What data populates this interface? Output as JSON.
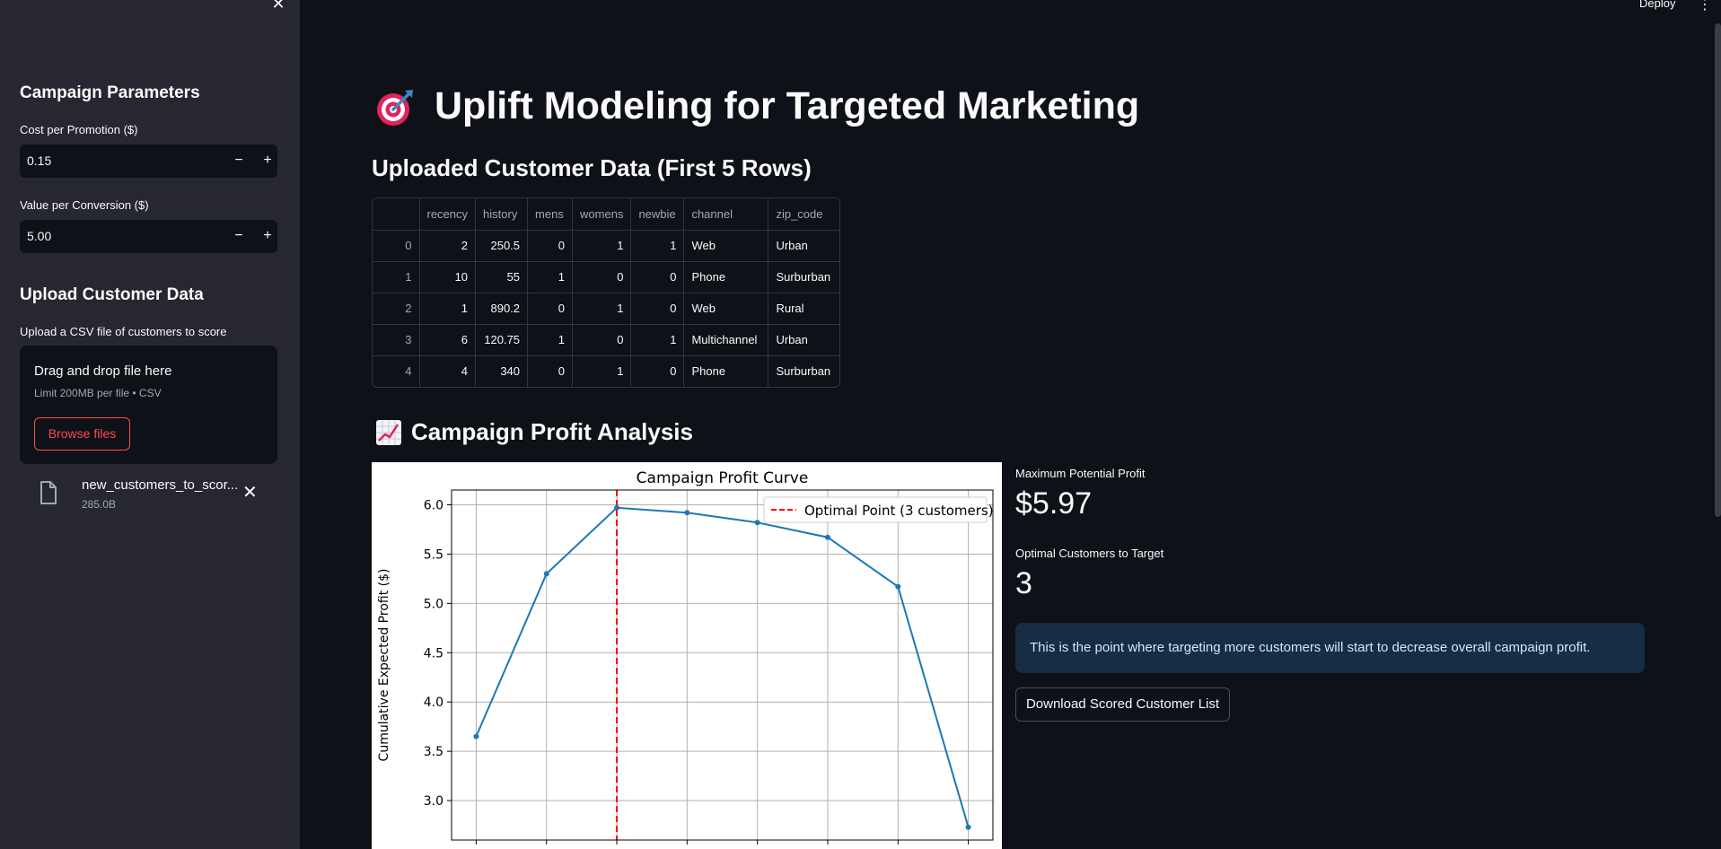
{
  "header": {
    "deploy_label": "Deploy",
    "menu_glyph": "⋮"
  },
  "sidebar": {
    "close_glyph": "✕",
    "campaign_heading": "Campaign Parameters",
    "cost": {
      "label": "Cost per Promotion ($)",
      "value": "0.15"
    },
    "value_conv": {
      "label": "Value per Conversion ($)",
      "value": "5.00"
    },
    "stepper": {
      "minus": "−",
      "plus": "+"
    },
    "upload_heading": "Upload Customer Data",
    "upload_label": "Upload a CSV file of customers to score",
    "dropzone": {
      "title": "Drag and drop file here",
      "limit": "Limit 200MB per file • CSV",
      "browse_label": "Browse files"
    },
    "file": {
      "name": "new_customers_to_scor...",
      "size": "285.0B",
      "remove_glyph": "✕"
    }
  },
  "main": {
    "title": "Uplift Modeling for Targeted Marketing",
    "data_heading": "Uploaded Customer Data (First 5 Rows)",
    "profit_heading": "Campaign Profit Analysis",
    "table": {
      "columns": [
        "",
        "recency",
        "history",
        "mens",
        "womens",
        "newbie",
        "channel",
        "zip_code"
      ],
      "rows": [
        [
          "0",
          "2",
          "250.5",
          "0",
          "1",
          "1",
          "Web",
          "Urban"
        ],
        [
          "1",
          "10",
          "55",
          "1",
          "0",
          "0",
          "Phone",
          "Surburban"
        ],
        [
          "2",
          "1",
          "890.2",
          "0",
          "1",
          "0",
          "Web",
          "Rural"
        ],
        [
          "3",
          "6",
          "120.75",
          "1",
          "0",
          "1",
          "Multichannel",
          "Urban"
        ],
        [
          "4",
          "4",
          "340",
          "0",
          "1",
          "0",
          "Phone",
          "Surburban"
        ]
      ]
    },
    "metrics": {
      "max_profit_label": "Maximum Potential Profit",
      "max_profit_value": "$5.97",
      "optimal_label": "Optimal Customers to Target",
      "optimal_value": "3"
    },
    "info_text": "This is the point where targeting more customers will start to decrease overall campaign profit.",
    "download_label": "Download Scored Customer List"
  },
  "chart_data": {
    "type": "line",
    "title": "Campaign Profit Curve",
    "xlabel": "",
    "ylabel": "Cumulative Expected Profit ($)",
    "x": [
      1,
      2,
      3,
      4,
      5,
      6,
      7,
      8
    ],
    "series": [
      {
        "values": [
          3.65,
          5.3,
          5.97,
          5.92,
          5.82,
          5.67,
          5.17,
          2.73
        ]
      }
    ],
    "vline": {
      "x": 3,
      "label": "Optimal Point (3 customers)",
      "color": "#ff0000"
    },
    "ylim": [
      2.6,
      6.15
    ],
    "xlim": [
      0.65,
      8.35
    ],
    "yticks": [
      "3.0",
      "3.5",
      "4.0",
      "4.5",
      "5.0",
      "5.5",
      "6.0"
    ],
    "grid": true,
    "legend": "top-right",
    "line_color": "#1f77b4"
  }
}
